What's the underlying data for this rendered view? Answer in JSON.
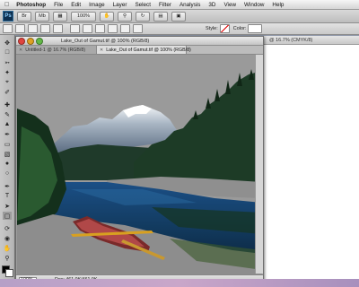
{
  "menubar": {
    "app_name": "Photoshop",
    "items": [
      "File",
      "Edit",
      "Image",
      "Layer",
      "Select",
      "Filter",
      "Analysis",
      "3D",
      "View",
      "Window",
      "Help"
    ]
  },
  "appbar": {
    "logo": "Ps",
    "zoom": "100%",
    "buttons": [
      "Br",
      "Mb"
    ]
  },
  "options": {
    "style_label": "Style:",
    "color_label": "Color:"
  },
  "document": {
    "title": "Lake_Out of Gamut.tif @ 100% (RGB/8)",
    "tabs": [
      {
        "label": "Untitled-1 @ 16.7% (RGB/8)",
        "active": false
      },
      {
        "label": "Lake_Out of Gamut.tif @ 100% (RGB/8)",
        "active": true
      }
    ],
    "zoom": "100%",
    "doc_size": "Doc: 461.0K/461.0K"
  },
  "background_doc": {
    "title_fragment": "@ 16.7% (CMYK/8)"
  },
  "colors": {
    "accent": "#0d2f4f",
    "close": "#e0443e",
    "minimize": "#dea123",
    "zoom": "#62b946",
    "gamut_gray": "#9a9a9a"
  },
  "icons": [
    "apple-icon",
    "move-icon",
    "marquee-icon",
    "lasso-icon",
    "wand-icon",
    "crop-icon",
    "eyedropper-icon",
    "brush-icon",
    "eraser-icon",
    "gradient-icon",
    "pen-icon",
    "type-icon",
    "hand-icon",
    "zoom-icon"
  ]
}
